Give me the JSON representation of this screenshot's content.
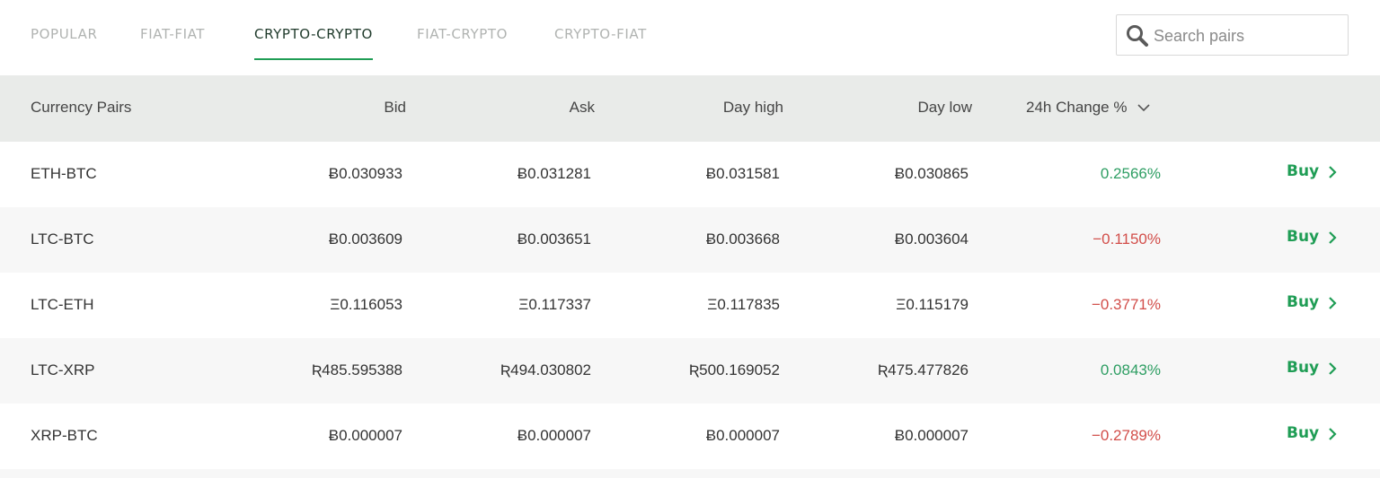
{
  "tabs": [
    {
      "label": "POPULAR",
      "active": false
    },
    {
      "label": "FIAT-FIAT",
      "active": false
    },
    {
      "label": "CRYPTO-CRYPTO",
      "active": true
    },
    {
      "label": "FIAT-CRYPTO",
      "active": false
    },
    {
      "label": "CRYPTO-FIAT",
      "active": false
    }
  ],
  "search": {
    "placeholder": "Search pairs",
    "value": ""
  },
  "table": {
    "headers": {
      "pair": "Currency Pairs",
      "bid": "Bid",
      "ask": "Ask",
      "day_high": "Day high",
      "day_low": "Day low",
      "change": "24h Change %"
    },
    "rows": [
      {
        "pair": "ETH-BTC",
        "bid": "Ƀ0.030933",
        "ask": "Ƀ0.031281",
        "high": "Ƀ0.031581",
        "low": "Ƀ0.030865",
        "change": "0.2566%",
        "trend": "up",
        "action": "Buy"
      },
      {
        "pair": "LTC-BTC",
        "bid": "Ƀ0.003609",
        "ask": "Ƀ0.003651",
        "high": "Ƀ0.003668",
        "low": "Ƀ0.003604",
        "change": "−0.1150%",
        "trend": "down",
        "action": "Buy"
      },
      {
        "pair": "LTC-ETH",
        "bid": "Ξ0.116053",
        "ask": "Ξ0.117337",
        "high": "Ξ0.117835",
        "low": "Ξ0.115179",
        "change": "−0.3771%",
        "trend": "down",
        "action": "Buy"
      },
      {
        "pair": "LTC-XRP",
        "bid": "Ʀ485.595388",
        "ask": "Ʀ494.030802",
        "high": "Ʀ500.169052",
        "low": "Ʀ475.477826",
        "change": "0.0843%",
        "trend": "up",
        "action": "Buy"
      },
      {
        "pair": "XRP-BTC",
        "bid": "Ƀ0.000007",
        "ask": "Ƀ0.000007",
        "high": "Ƀ0.000007",
        "low": "Ƀ0.000007",
        "change": "−0.2789%",
        "trend": "down",
        "action": "Buy"
      }
    ]
  },
  "colors": {
    "accent_green": "#1f9d55",
    "positive": "#2e9e63",
    "negative": "#d24e4a",
    "header_bg": "#e9ebe9",
    "alt_row_bg": "#f7f7f7"
  },
  "icons": {
    "search": "search-icon",
    "sort": "chevron-down-icon",
    "buy": "chevron-right-icon"
  }
}
